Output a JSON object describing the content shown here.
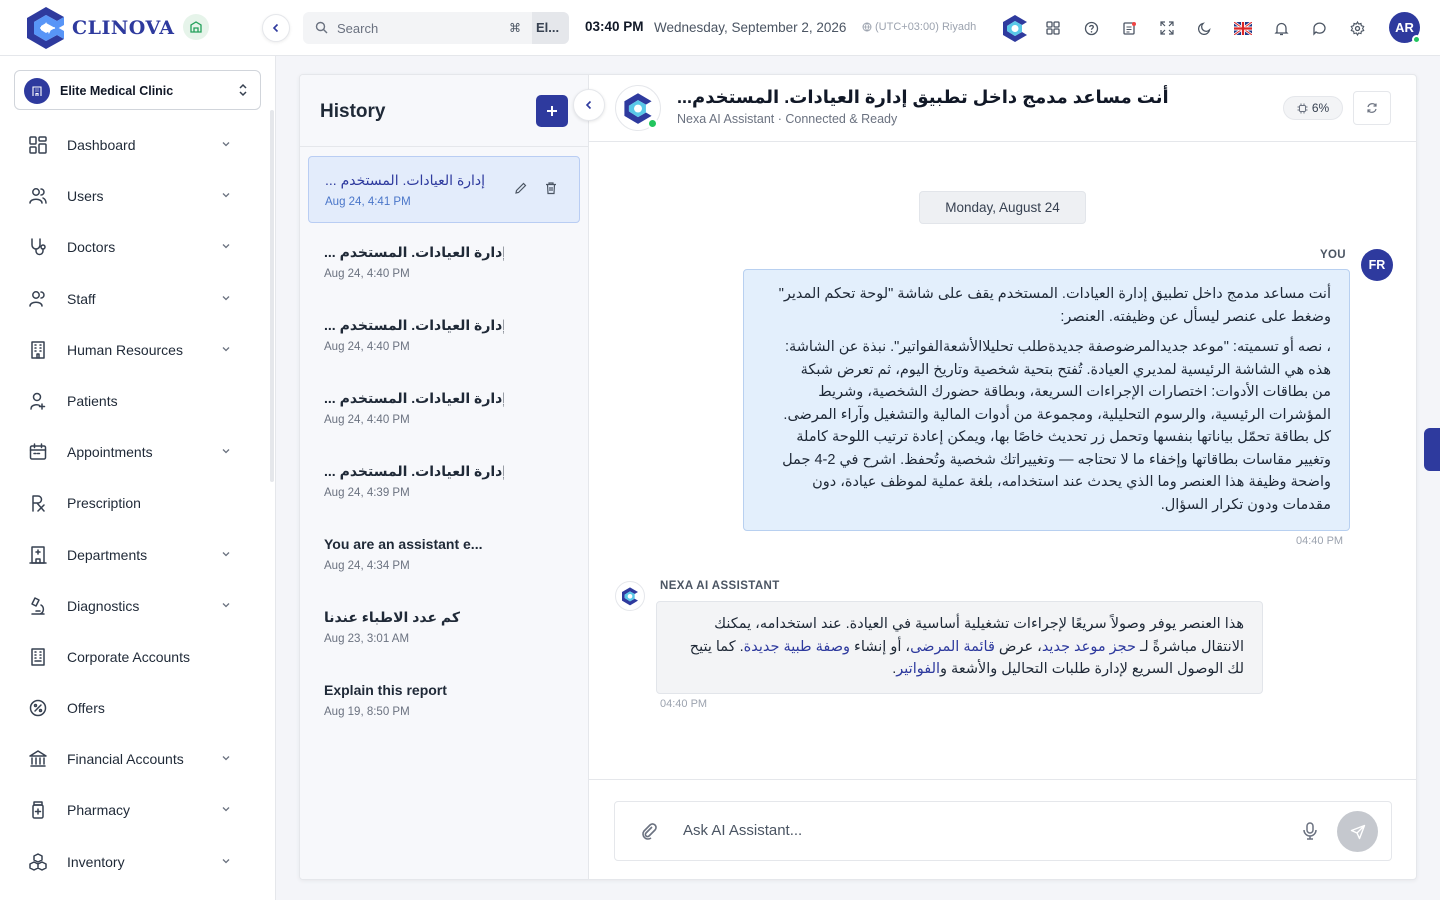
{
  "brand": {
    "name": "CLINOVA"
  },
  "header": {
    "search_placeholder": "Search",
    "search_shortcut": "⌘",
    "search_scope": "El...",
    "time": "03:40 PM",
    "date": "Wednesday, September 2, 2026",
    "timezone": "(UTC+03:00) Riyadh",
    "user_initials": "AR",
    "icons": [
      "nexa-logo-icon",
      "apps-grid-icon",
      "help-icon",
      "notes-icon",
      "fullscreen-icon",
      "dark-mode-icon",
      "uk-flag-icon",
      "bell-icon",
      "chat-icon",
      "settings-icon"
    ]
  },
  "sidebar": {
    "clinic_name": "Elite Medical Clinic",
    "items": [
      {
        "label": "Dashboard",
        "icon": "dashboard-icon",
        "has_children": true
      },
      {
        "label": "Users",
        "icon": "users-icon",
        "has_children": true
      },
      {
        "label": "Doctors",
        "icon": "stethoscope-icon",
        "has_children": true
      },
      {
        "label": "Staff",
        "icon": "staff-icon",
        "has_children": true
      },
      {
        "label": "Human Resources",
        "icon": "building-icon",
        "has_children": true
      },
      {
        "label": "Patients",
        "icon": "patient-icon",
        "has_children": false
      },
      {
        "label": "Appointments",
        "icon": "calendar-icon",
        "has_children": true
      },
      {
        "label": "Prescription",
        "icon": "rx-icon",
        "has_children": false
      },
      {
        "label": "Departments",
        "icon": "hospital-icon",
        "has_children": true
      },
      {
        "label": "Diagnostics",
        "icon": "microscope-icon",
        "has_children": true
      },
      {
        "label": "Corporate Accounts",
        "icon": "corporate-icon",
        "has_children": false
      },
      {
        "label": "Offers",
        "icon": "percent-icon",
        "has_children": false
      },
      {
        "label": "Financial Accounts",
        "icon": "bank-icon",
        "has_children": true
      },
      {
        "label": "Pharmacy",
        "icon": "medicine-bottle-icon",
        "has_children": true
      },
      {
        "label": "Inventory",
        "icon": "boxes-icon",
        "has_children": true
      }
    ]
  },
  "history": {
    "title": "History",
    "items": [
      {
        "title": "... إدارة العيادات. المستخدم",
        "date": "Aug 24, 4:41 PM",
        "active": true
      },
      {
        "title": "... إدارة العيادات. المستخدم",
        "date": "Aug 24, 4:40 PM",
        "active": false
      },
      {
        "title": "... إدارة العيادات. المستخدم",
        "date": "Aug 24, 4:40 PM",
        "active": false
      },
      {
        "title": "... إدارة العيادات. المستخدم",
        "date": "Aug 24, 4:40 PM",
        "active": false
      },
      {
        "title": "... إدارة العيادات. المستخدم",
        "date": "Aug 24, 4:39 PM",
        "active": false
      },
      {
        "title": "You are an assistant e...",
        "date": "Aug 24, 4:34 PM",
        "active": false
      },
      {
        "title": "كم عدد الاطباء عندنا",
        "date": "Aug 23, 3:01 AM",
        "active": false
      },
      {
        "title": "Explain this report",
        "date": "Aug 19, 8:50 PM",
        "active": false
      }
    ]
  },
  "chat": {
    "title": "أنت مساعد مدمج داخل تطبيق إدارة العيادات. المستخدم...",
    "subtitle": "Nexa AI Assistant · Connected & Ready",
    "usage": "6%",
    "day_label": "Monday, August 24",
    "user_label": "YOU",
    "user_initials": "FR",
    "user_message_p1": "أنت مساعد مدمج داخل تطبيق إدارة العيادات. المستخدم يقف على شاشة \"لوحة تحكم المدير\" وضغط على عنصر ليسأل عن وظيفته. العنصر:",
    "user_message_p2": "، نصه أو تسميته: \"موعد جديدالمرضوصفة جديدةطلب تحليلاالأشعةالفواتير\". نبذة عن الشاشة: هذه هي الشاشة الرئيسية لمديري العيادة. تُفتح بتحية شخصية وتاريخ اليوم، ثم تعرض شبكة من بطاقات الأدوات: اختصارات الإجراءات السريعة، وبطاقة حضورك الشخصية، وشريط المؤشرات الرئيسية، والرسوم التحليلية، ومجموعة من أدوات المالية والتشغيل وآراء المرضى. كل بطاقة تحمّل بياناتها بنفسها وتحمل زر تحديث خاصًا بها، ويمكن إعادة ترتيب اللوحة كاملة وتغيير مقاسات بطاقاتها وإخفاء ما لا تحتاجه — وتغييراتك شخصية وتُحفظ. اشرح في 2-4 جمل واضحة وظيفة هذا العنصر وما الذي يحدث عند استخدامه، بلغة عملية لموظف عيادة، دون مقدمات ودون تكرار السؤال.",
    "user_time": "04:40 PM",
    "bot_label": "NEXA AI ASSISTANT",
    "bot_message_a": "هذا العنصر يوفر وصولاً سريعًا لإجراءات تشغيلية أساسية في العيادة. عند استخدامه، يمكنك الانتقال مباشرةً لـ ",
    "bot_link_1": "حجز موعد جديد",
    "bot_message_b": "، عرض ",
    "bot_link_2": "قائمة المرضى",
    "bot_message_c": "، أو إنشاء ",
    "bot_link_3": "وصفة طبية جديدة",
    "bot_message_d": ". كما يتيح لك الوصول السريع لإدارة طلبات التحاليل والأشعة و",
    "bot_link_4": "الفواتير",
    "bot_message_e": ".",
    "bot_time": "04:40 PM",
    "input_placeholder": "Ask AI Assistant..."
  },
  "colors": {
    "primary": "#2e3a9e",
    "online": "#22c55e",
    "user_bubble": "#e3effc",
    "bot_bubble": "#f3f4f6"
  }
}
